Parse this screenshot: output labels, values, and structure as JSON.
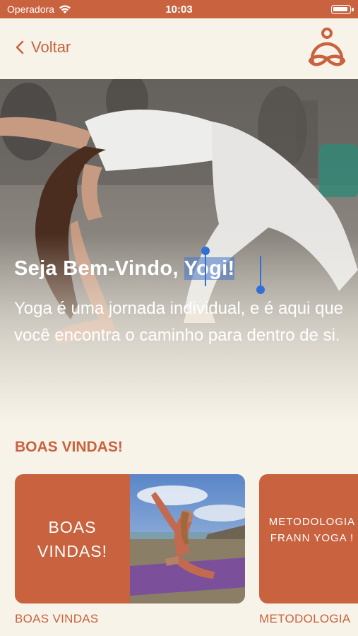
{
  "status": {
    "carrier": "Operadora",
    "time": "10:03"
  },
  "nav": {
    "back_label": "Voltar"
  },
  "hero": {
    "title_plain": "Seja Bem-Vindo, ",
    "title_selected": "Yogi!",
    "subtitle": "Yoga é uma jornada individual, e é aqui que você encontra o caminho para dentro de si."
  },
  "section": {
    "title": "BOAS VINDAS!"
  },
  "cards": [
    {
      "label": "BOAS VINDAS!",
      "caption": "BOAS VINDAS"
    },
    {
      "label": "METODOLOGIA FRANN YOGA !",
      "caption": "METODOLOGIA"
    }
  ],
  "colors": {
    "accent": "#c9623f",
    "background": "#f7f3e8",
    "selection": "#2f6fd6"
  }
}
